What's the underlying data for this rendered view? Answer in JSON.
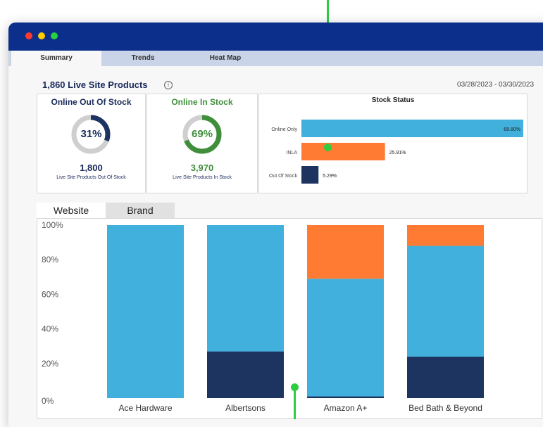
{
  "tabs": [
    {
      "label": "Summary",
      "active": true
    },
    {
      "label": "Trends",
      "active": false
    },
    {
      "label": "Heat Map",
      "active": false
    }
  ],
  "header": {
    "live_title": "1,860 Live Site Products",
    "info_icon": "i",
    "date_range": "03/28/2023 - 03/30/2023"
  },
  "cards": {
    "out_of_stock": {
      "title": "Online Out Of Stock",
      "percent": "31%",
      "value": 0.31,
      "count": "1,800",
      "caption": "Live Site Products Out Of Stock",
      "color": "#1d3461"
    },
    "in_stock": {
      "title": "Online In Stock",
      "percent": "69%",
      "value": 0.69,
      "count": "3,970",
      "caption": "Live Site Products In Stock",
      "color": "#3f8f3a"
    }
  },
  "stock_status": {
    "title": "Stock Status",
    "bars": [
      {
        "label": "Online Only",
        "value": 68.8,
        "text": "68.80%",
        "color": "#41b0dd"
      },
      {
        "label": "INLA",
        "value": 25.91,
        "text": "25.91%",
        "color": "#ff7a33"
      },
      {
        "label": "Out Of Stock",
        "value": 5.29,
        "text": "5.29%",
        "color": "#1d3461"
      }
    ]
  },
  "segment_tabs": {
    "website": "Website",
    "brand": "Brand"
  },
  "colors": {
    "titlebar": "#0b2f8a",
    "dot_red": "#ff3b30",
    "dot_yellow": "#ffcc00",
    "dot_green": "#28d13e",
    "annotation": "#2ecc40"
  },
  "chart_data": {
    "type": "bar",
    "stacked": true,
    "categories": [
      "Ace Hardware",
      "Albertsons",
      "Amazon A+",
      "Bed Bath & Beyond"
    ],
    "series": [
      {
        "color": "#1d3461",
        "values": [
          0,
          27,
          1,
          24
        ]
      },
      {
        "color": "#41b0dd",
        "values": [
          100,
          73,
          68,
          64
        ]
      },
      {
        "color": "#ff7a33",
        "values": [
          0,
          0,
          31,
          12
        ]
      }
    ],
    "yticks": [
      "0%",
      "20%",
      "40%",
      "60%",
      "80%",
      "100%"
    ],
    "ylim": [
      0,
      100
    ]
  }
}
